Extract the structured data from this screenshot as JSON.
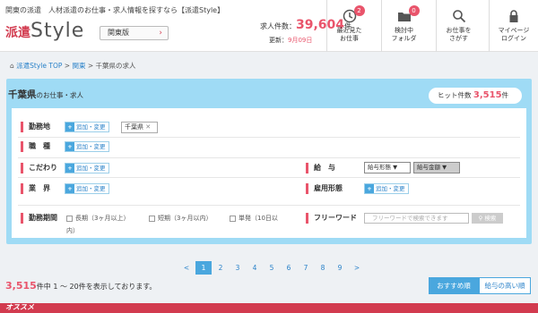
{
  "header": {
    "tagline": "関東の派遣　人材派遣のお仕事・求人情報を探すなら【派遣Style】",
    "logo_kanji": "派遣",
    "logo_style": "Style",
    "region_button": "関東版",
    "job_count_label": "求人件数：",
    "job_count": "39,604",
    "job_count_unit": "件",
    "updated_label": "更新：",
    "updated_date": "9月09日",
    "nav": [
      {
        "label1": "最近見た",
        "label2": "お仕事",
        "badge": "2",
        "icon": "clock-icon"
      },
      {
        "label1": "検討中",
        "label2": "フォルダ",
        "badge": "0",
        "icon": "folder-icon"
      },
      {
        "label1": "お仕事を",
        "label2": "さがす",
        "badge": "",
        "icon": "search-icon"
      },
      {
        "label1": "マイページ",
        "label2": "ログイン",
        "badge": "",
        "icon": "lock-icon"
      }
    ]
  },
  "breadcrumb": {
    "home": "派遣Style TOP",
    "sep": ">",
    "region": "関東",
    "current": "千葉県の求人"
  },
  "search": {
    "pref": "千葉県",
    "sub": "のお仕事・求人",
    "hit_label": "ヒット件数",
    "hit_count": "3,515",
    "hit_unit": "件",
    "add_change": "追加・変更",
    "location_label": "勤務地",
    "location_chip": "千葉県",
    "chip_close": "✕",
    "occupation_label": "職　種",
    "kodawari_label": "こだわり",
    "industry_label": "業　界",
    "salary_label": "給　与",
    "salary_type": "給与形態",
    "salary_amount": "給与金額",
    "employment_label": "雇用形態",
    "period_label": "勤務期間",
    "period_long": "長期（3ヶ月以上）",
    "period_short": "短期（3ヶ月以内）",
    "period_single": "単発（10日以",
    "period_single2": "内）",
    "freeword_label": "フリーワード",
    "freeword_placeholder": "フリーワードで検索できます",
    "search_button": "検索"
  },
  "pager": {
    "prev": "<",
    "pages": [
      "1",
      "2",
      "3",
      "4",
      "5",
      "6",
      "7",
      "8",
      "9"
    ],
    "next": ">"
  },
  "result": {
    "count": "3,515",
    "text": "件中 1 ～ 20件を表示しております。"
  },
  "sort": {
    "recommended": "おすすめ順",
    "salary_high": "給与の高い順"
  },
  "bottom": {
    "label": "オススメ"
  },
  "colors": {
    "accent": "#e9546b",
    "blue": "#4aa7de",
    "panel": "#9fdbf5"
  }
}
